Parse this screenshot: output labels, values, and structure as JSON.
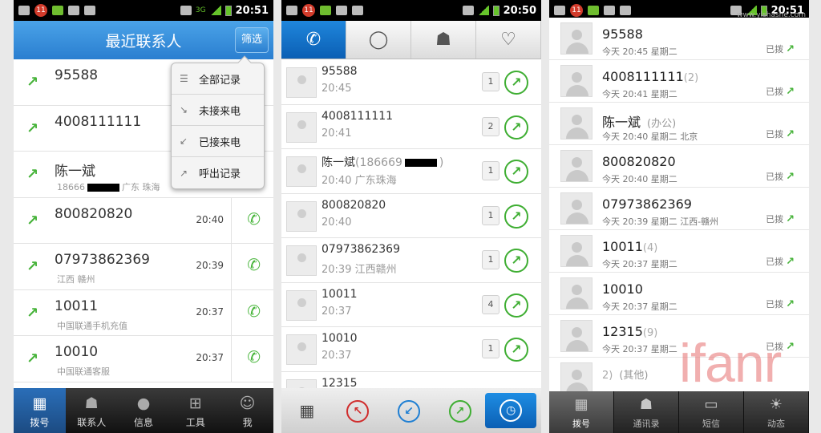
{
  "status": {
    "time1": "20:51",
    "time2": "20:50",
    "time3": "20:51",
    "notif_count": "11",
    "network": "3G"
  },
  "watermark": {
    "site": "www.ylshashe.com",
    "brand": "ifanr"
  },
  "phone1": {
    "title": "最近联系人",
    "filter_label": "筛选",
    "filter_menu": [
      "全部记录",
      "未接来电",
      "已接来电",
      "呼出记录"
    ],
    "rows": [
      {
        "number": "95588",
        "sub": "",
        "time": ""
      },
      {
        "number": "4008111111",
        "sub": "",
        "time": ""
      },
      {
        "number": "陈一斌",
        "sub_prefix": "18666",
        "sub": "广东 珠海",
        "time": ""
      },
      {
        "number": "800820820",
        "sub": "",
        "time": "20:40"
      },
      {
        "number": "07973862369",
        "sub": "江西 赣州",
        "time": "20:39"
      },
      {
        "number": "10011",
        "sub": "中国联通手机充值",
        "time": "20:37"
      },
      {
        "number": "10010",
        "sub": "中国联通客服",
        "time": "20:37"
      }
    ],
    "tabs": [
      "拨号",
      "联系人",
      "信息",
      "工具",
      "我"
    ]
  },
  "phone2": {
    "rows": [
      {
        "number": "95588",
        "paren": "",
        "sub": "20:45",
        "count": "1"
      },
      {
        "number": "4008111111",
        "paren": "",
        "sub": "20:41",
        "count": "2"
      },
      {
        "number": "陈一斌",
        "paren": "(186669",
        "paren_end": ")",
        "sub": "20:40 广东珠海",
        "count": "1"
      },
      {
        "number": "800820820",
        "paren": "",
        "sub": "20:40",
        "count": "1"
      },
      {
        "number": "07973862369",
        "paren": "",
        "sub": "20:39 江西赣州",
        "count": "1"
      },
      {
        "number": "10011",
        "paren": "",
        "sub": "20:37",
        "count": "4"
      },
      {
        "number": "10010",
        "paren": "",
        "sub": "20:37",
        "count": "1"
      },
      {
        "number": "12315",
        "paren": "",
        "sub": "",
        "count": ""
      }
    ]
  },
  "phone3": {
    "rows": [
      {
        "number": "95588",
        "paren": "",
        "tag": "",
        "sub": "今天 20:45 星期二",
        "status": "已拨"
      },
      {
        "number": "4008111111",
        "paren": "(2)",
        "tag": "",
        "sub": "今天 20:41 星期二",
        "status": "已拨"
      },
      {
        "number": "陈一斌",
        "paren": "",
        "tag": "(办公)",
        "sub": "今天 20:40 星期二 北京",
        "status": "已拨"
      },
      {
        "number": "800820820",
        "paren": "",
        "tag": "",
        "sub": "今天 20:40 星期二",
        "status": "已拨"
      },
      {
        "number": "07973862369",
        "paren": "",
        "tag": "",
        "sub": "今天 20:39 星期二 江西-赣州",
        "status": "已拨"
      },
      {
        "number": "10011",
        "paren": "(4)",
        "tag": "",
        "sub": "今天 20:37 星期二",
        "status": "已拨"
      },
      {
        "number": "10010",
        "paren": "",
        "tag": "",
        "sub": "今天 20:37 星期二",
        "status": "已拨"
      },
      {
        "number": "12315",
        "paren": "(9)",
        "tag": "",
        "sub": "今天 20:37 星期二",
        "status": "已拨"
      },
      {
        "number": "",
        "paren": "2)",
        "tag": "(其他)",
        "sub": "",
        "status": ""
      }
    ],
    "tabs": [
      "拨号",
      "通讯录",
      "短信",
      "动态"
    ]
  }
}
